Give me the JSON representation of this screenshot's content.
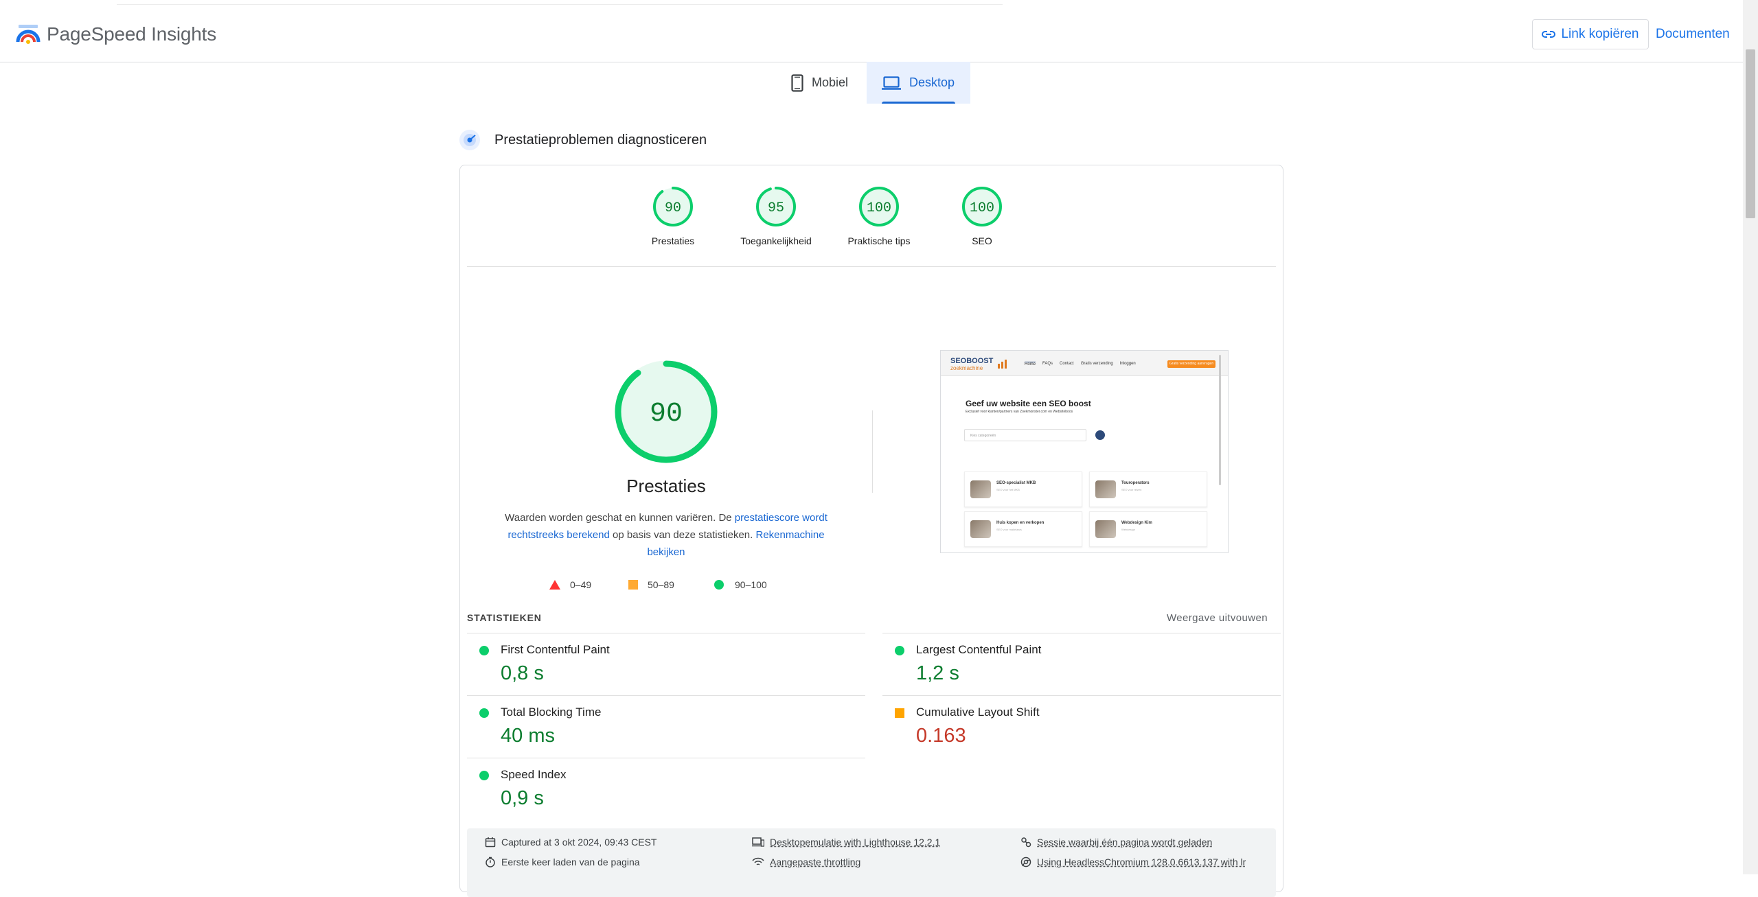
{
  "header": {
    "app_name": "PageSpeed Insights",
    "copy_link_label": "Link kopiëren",
    "docs_label": "Documenten"
  },
  "device_tabs": [
    {
      "label": "Mobiel",
      "selected": false,
      "icon": "smartphone-icon"
    },
    {
      "label": "Desktop",
      "selected": true,
      "icon": "laptop-icon"
    }
  ],
  "section": {
    "title": "Prestatieproblemen diagnosticeren"
  },
  "categories": [
    {
      "score": "90",
      "label": "Prestaties",
      "fraction": 0.9
    },
    {
      "score": "95",
      "label": "Toegankelijkheid",
      "fraction": 0.95
    },
    {
      "score": "100",
      "label": "Praktische tips",
      "fraction": 1.0
    },
    {
      "score": "100",
      "label": "SEO",
      "fraction": 1.0
    }
  ],
  "performance": {
    "score": "90",
    "fraction": 0.9,
    "title": "Prestaties",
    "desc_part1": "Waarden worden geschat en kunnen variëren. De ",
    "desc_link1": "prestatiescore wordt rechtstreeks berekend",
    "desc_part2": " op basis van deze statistieken. ",
    "desc_link2": "Rekenmachine bekijken"
  },
  "legend": [
    {
      "range": "0–49",
      "shape": "triangle",
      "color": "#ff3333"
    },
    {
      "range": "50–89",
      "shape": "square",
      "color": "#ffaa33"
    },
    {
      "range": "90–100",
      "shape": "circle",
      "color": "#0cce6b"
    }
  ],
  "screenshot": {
    "logo_top": "SEOBOOST",
    "logo_bottom": "zoekmachine",
    "nav": [
      "Home",
      "FAQs",
      "Contact",
      "Gratis verzending",
      "Inloggen"
    ],
    "cta": "Gratis verzending aanvragen",
    "headline": "Geef uw website een SEO boost",
    "subline": "Exclusief voor klanten/partners van Zoekmonster.com en Websiteboos",
    "search_placeholder": "Kies categorieën",
    "cards": [
      {
        "title": "SEO-specialist MKB",
        "sub": "SEO voor het MKB"
      },
      {
        "title": "Touroperators",
        "sub": "SEO voor reizen"
      },
      {
        "title": "Huis kopen en verkopen",
        "sub": "SEO voor makelaars"
      },
      {
        "title": "Webdesign Kim",
        "sub": "Webdesign"
      }
    ]
  },
  "stats": {
    "heading": "STATISTIEKEN",
    "expand_label": "Weergave uitvouwen",
    "left": [
      {
        "name": "First Contentful Paint",
        "value": "0,8 s",
        "rating": "good"
      },
      {
        "name": "Total Blocking Time",
        "value": "40 ms",
        "rating": "good"
      },
      {
        "name": "Speed Index",
        "value": "0,9 s",
        "rating": "good"
      }
    ],
    "right": [
      {
        "name": "Largest Contentful Paint",
        "value": "1,2 s",
        "rating": "good"
      },
      {
        "name": "Cumulative Layout Shift",
        "value": "0.163",
        "rating": "average"
      }
    ]
  },
  "footer": {
    "captured": "Captured at 3 okt 2024, 09:43 CEST",
    "first_load": "Eerste keer laden van de pagina",
    "emulation": "Desktopemulatie with Lighthouse 12.2.1",
    "throttling": "Aangepaste throttling",
    "session": "Sessie waarbij één pagina wordt geladen",
    "browser": "Using HeadlessChromium 128.0.6613.137 with lr"
  },
  "colors": {
    "good": "#0cce6b",
    "good_text": "#0c7d2f",
    "average": "#ffa400",
    "poor": "#ff4e42",
    "accent": "#1a73e8"
  }
}
